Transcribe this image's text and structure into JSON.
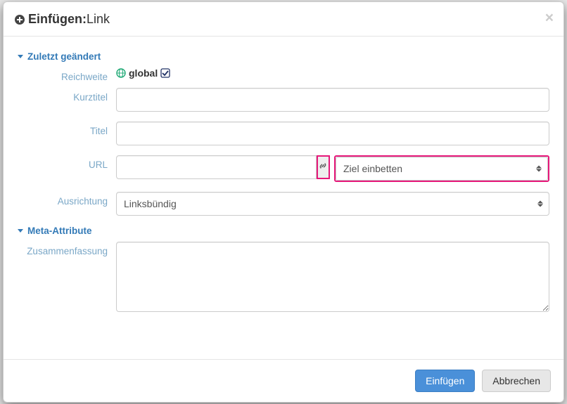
{
  "modal": {
    "title_prefix": "Einfügen:",
    "title_suffix": "Link",
    "close": "×"
  },
  "sections": {
    "last_changed": "Zuletzt geändert",
    "meta": "Meta-Attribute"
  },
  "labels": {
    "scope": "Reichweite",
    "shorttitle": "Kurztitel",
    "title": "Titel",
    "url": "URL",
    "align": "Ausrichtung",
    "summary": "Zusammenfassung"
  },
  "values": {
    "scope_global": "global",
    "shorttitle": "",
    "title": "",
    "url": "",
    "ziel_selected": "Ziel einbetten",
    "align_selected": "Linksbündig",
    "summary": ""
  },
  "buttons": {
    "insert": "Einfügen",
    "cancel": "Abbrechen"
  },
  "icons": {
    "plus": "plus-circle-icon",
    "globe": "globe-icon",
    "check": "checkbox-checked-icon",
    "link": "link-icon",
    "close": "close-icon"
  }
}
